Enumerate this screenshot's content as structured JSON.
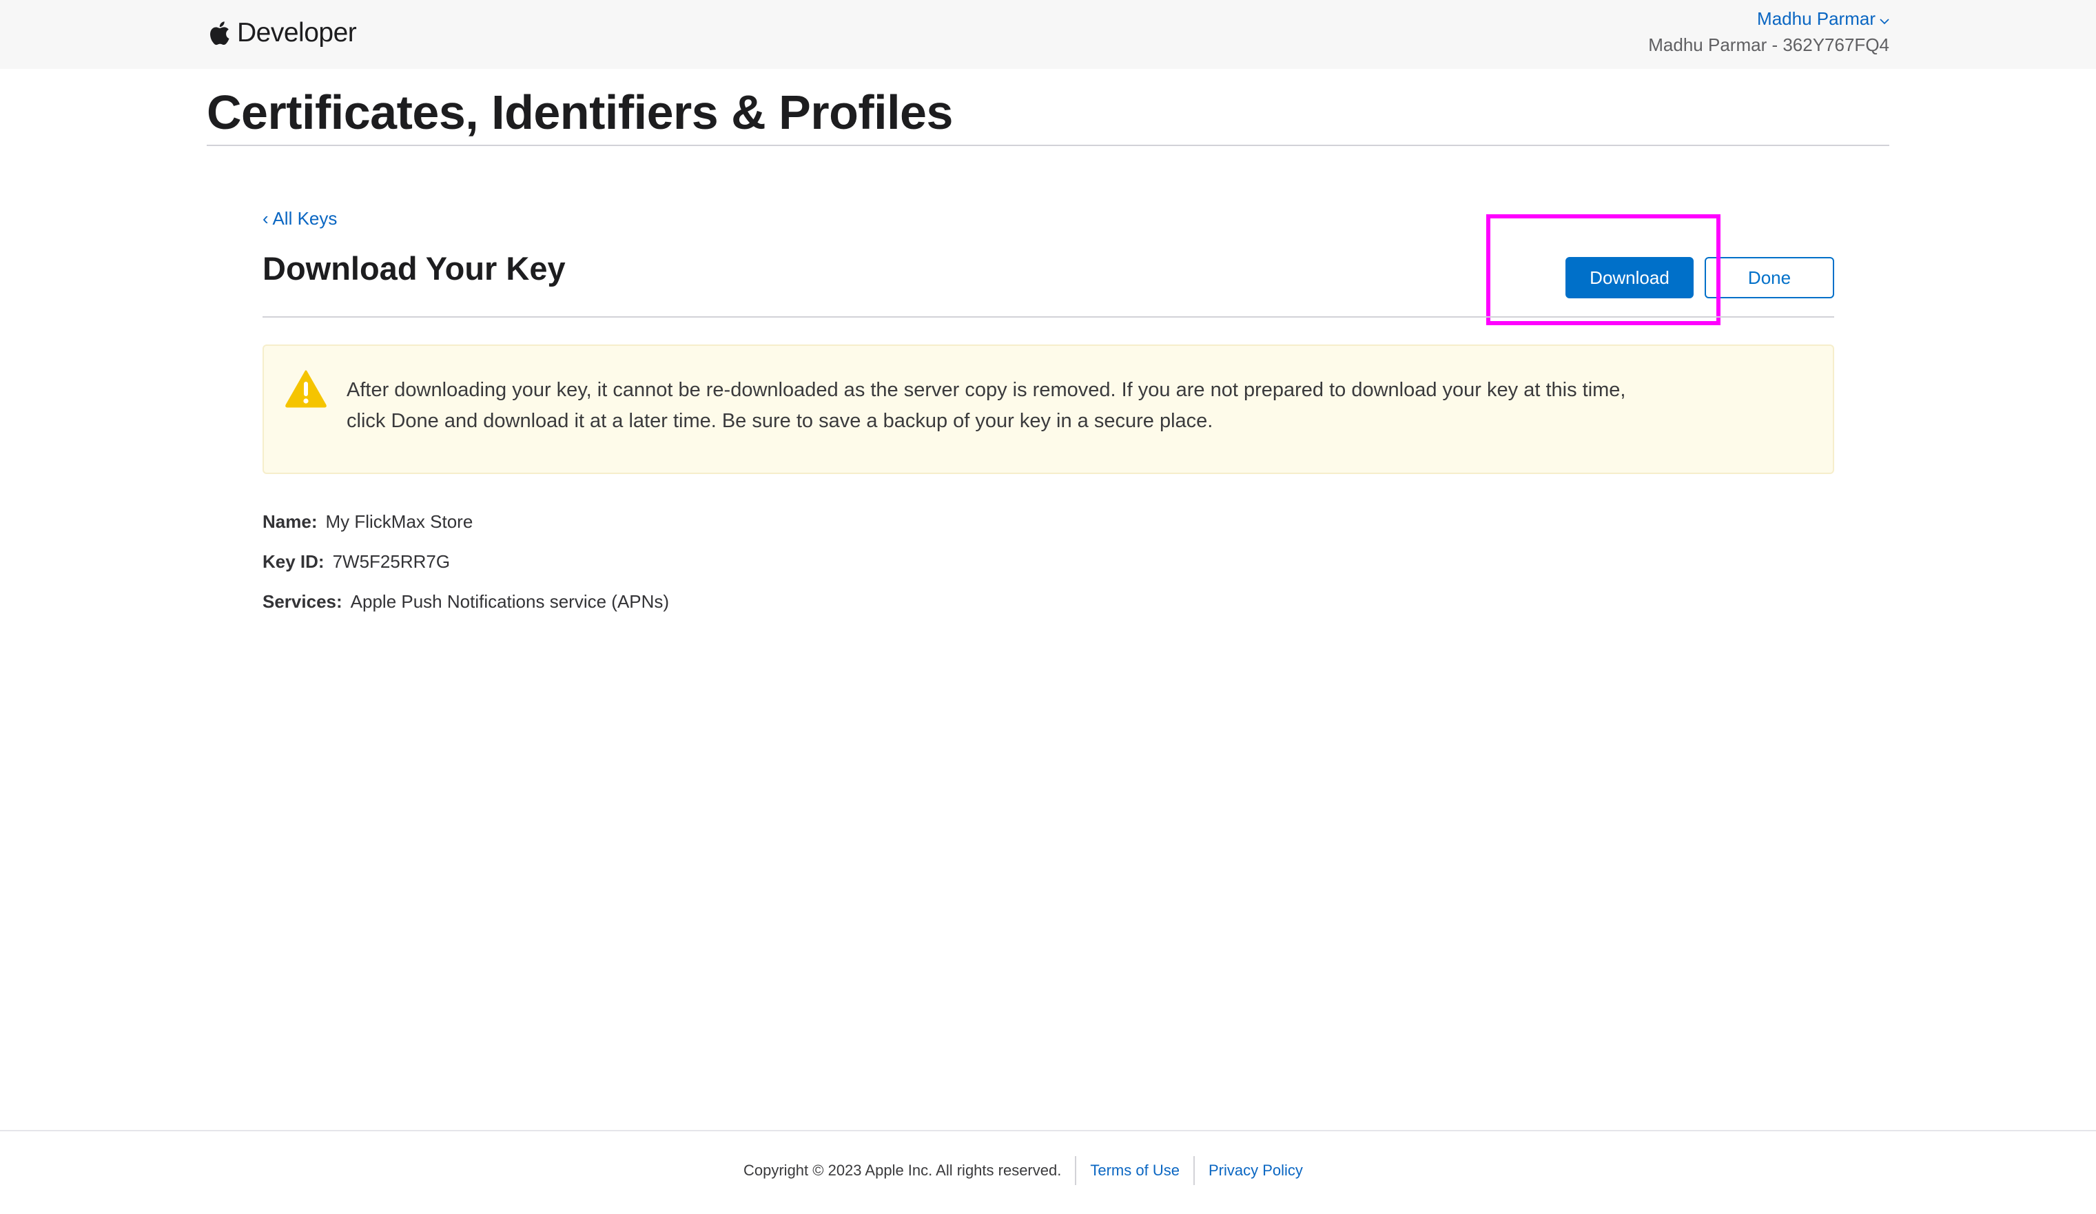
{
  "header": {
    "brand": "Developer",
    "account_name": "Madhu Parmar",
    "account_team": "Madhu Parmar - 362Y767FQ4",
    "icons": {
      "logo": "apple-logo-icon",
      "account_menu": "chevron-down-icon"
    }
  },
  "page": {
    "title": "Certificates, Identifiers & Profiles"
  },
  "key_page": {
    "back_link": "‹ All Keys",
    "title": "Download Your Key",
    "download_button": "Download",
    "done_button": "Done"
  },
  "warning": {
    "icon": "warning-icon",
    "text": "After downloading your key, it cannot be re-downloaded as the server copy is removed. If you are not prepared to download your key at this time, click Done and download it at a later time. Be sure to save a backup of your key in a secure place."
  },
  "details": {
    "name_label": "Name:",
    "name_value": "My FlickMax Store",
    "key_id_label": "Key ID:",
    "key_id_value": "7W5F25RR7G",
    "services_label": "Services:",
    "services_value": "Apple Push Notifications service (APNs)"
  },
  "footer": {
    "copyright": "Copyright © 2023 Apple Inc. All rights reserved.",
    "terms": "Terms of Use",
    "privacy": "Privacy Policy"
  },
  "colors": {
    "accent": "#0070c9",
    "link": "#0a66c2",
    "warning_bg": "#fefbea",
    "warning_icon": "#f5c400",
    "highlight": "#ff00ff"
  }
}
